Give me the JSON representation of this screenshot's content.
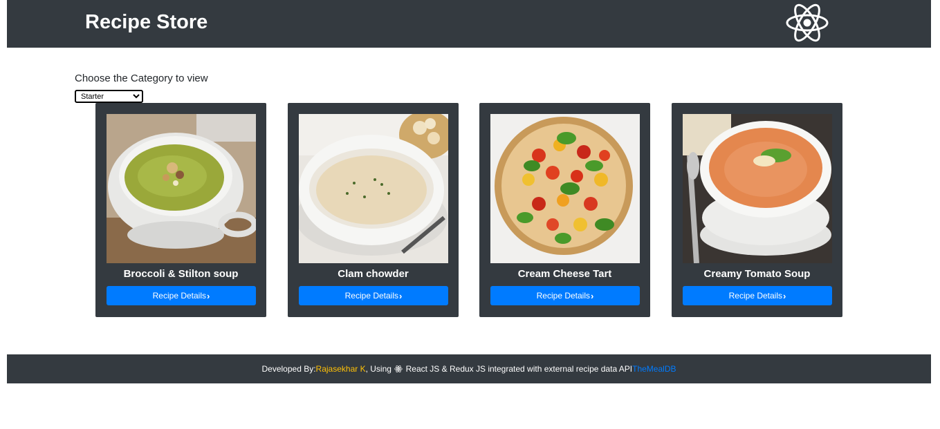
{
  "header": {
    "title": "Recipe Store",
    "logo_icon": "react-logo-icon"
  },
  "category": {
    "label": "Choose the Category to view",
    "selected": "Starter"
  },
  "cards": [
    {
      "title": "Broccoli & Stilton soup",
      "button_label": "Recipe Details",
      "image": "green-soup-bowl"
    },
    {
      "title": "Clam chowder",
      "button_label": "Recipe Details",
      "image": "chowder-bowl"
    },
    {
      "title": "Cream Cheese Tart",
      "button_label": "Recipe Details",
      "image": "tomato-tart"
    },
    {
      "title": "Creamy Tomato Soup",
      "button_label": "Recipe Details",
      "image": "tomato-soup-bowl"
    }
  ],
  "footer": {
    "prefix": "Developed By:",
    "author": "Rajasekhar K",
    "middle_before_icon": ", Using ",
    "middle_after_icon": " React JS & Redux JS integrated with external recipe data API",
    "api_name": "TheMealDB"
  },
  "colors": {
    "header_bg": "#343a40",
    "button_bg": "#007bff",
    "author_link": "#ffc107",
    "api_link": "#007bff"
  }
}
